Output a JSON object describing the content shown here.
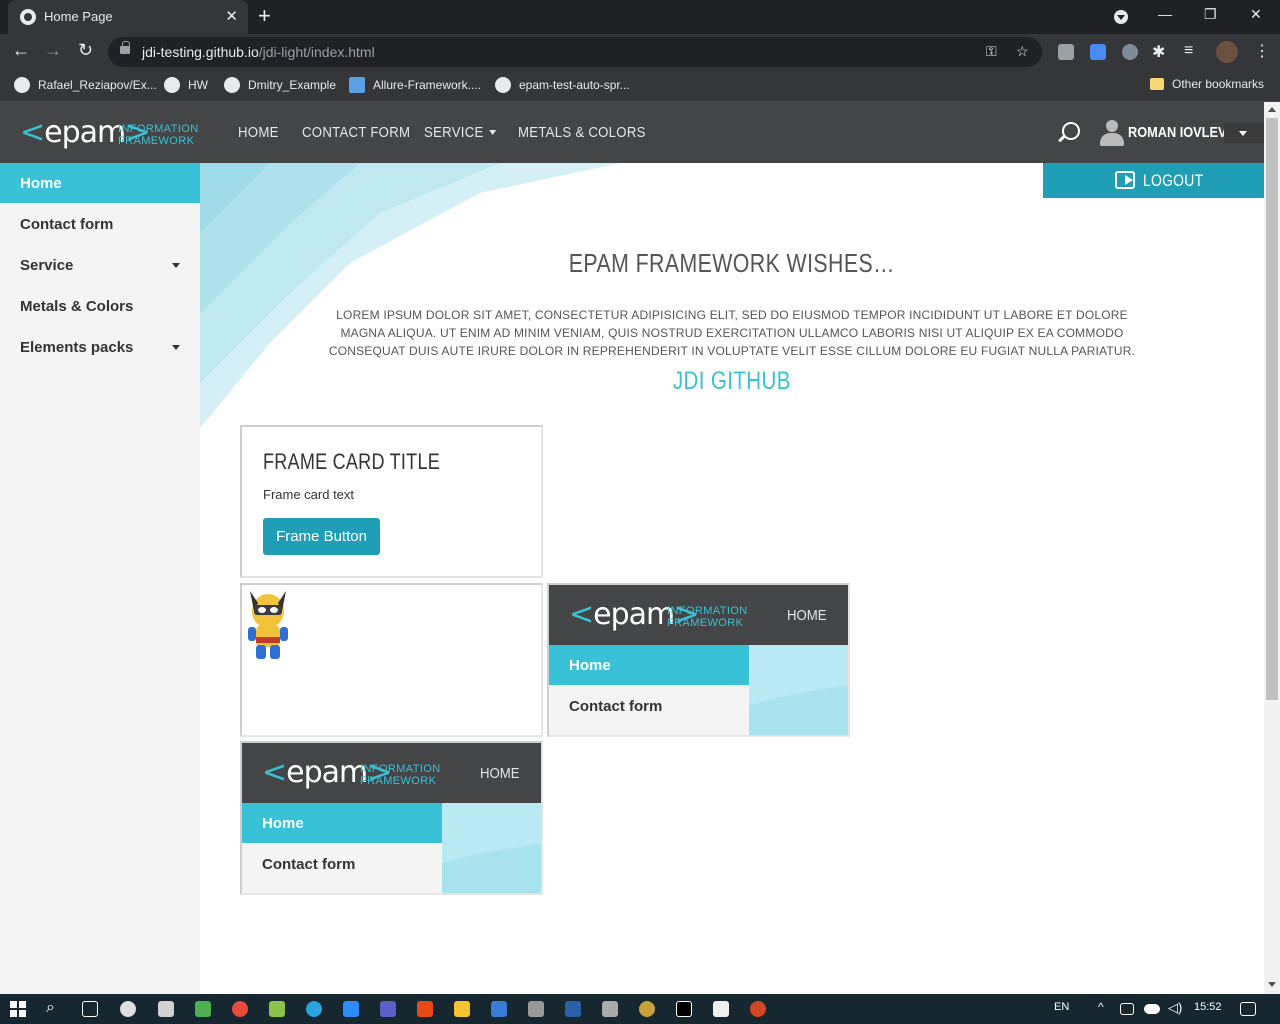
{
  "browser": {
    "tab_title": "Home Page",
    "tab_close": "✕",
    "new_tab": "+",
    "url_host": "jdi-testing.github.io",
    "url_path": "/jdi-light/index.html",
    "bookmarks": [
      {
        "label": "Rafael_Reziapov/Ex..."
      },
      {
        "label": "HW"
      },
      {
        "label": "Dmitry_Example"
      },
      {
        "label": "Allure-Framework...."
      },
      {
        "label": "epam-test-auto-spr..."
      }
    ],
    "other_bookmarks": "Other bookmarks",
    "win_min": "—",
    "win_restore": "❐",
    "win_close": "✕"
  },
  "site": {
    "logo_text_left": "<",
    "logo_text": "epam",
    "logo_text_right": ">",
    "logo_tag_line1": "INFORMATION",
    "logo_tag_line2": "FRAMEWORK",
    "nav": {
      "home": "HOME",
      "contact": "CONTACT FORM",
      "service": "SERVICE",
      "metals": "METALS & COLORS"
    },
    "user_name": "ROMAN IOVLEV",
    "logout": "LOGOUT",
    "sidebar": [
      {
        "label": "Home",
        "active": true
      },
      {
        "label": "Contact form"
      },
      {
        "label": "Service"
      },
      {
        "label": "Metals & Colors"
      },
      {
        "label": "Elements packs"
      }
    ],
    "main_title": "EPAM FRAMEWORK WISHES…",
    "main_text": "LOREM IPSUM DOLOR SIT AMET, CONSECTETUR ADIPISICING ELIT, SED DO EIUSMOD TEMPOR INCIDIDUNT UT LABORE ET DOLORE MAGNA ALIQUA. UT ENIM AD MINIM VENIAM, QUIS NOSTRUD EXERCITATION ULLAMCO LABORIS NISI UT ALIQUIP EX EA COMMODO CONSEQUAT DUIS AUTE IRURE DOLOR IN REPREHENDERIT IN VOLUPTATE VELIT ESSE CILLUM DOLORE EU FUGIAT NULLA PARIATUR.",
    "jdi_link": "JDI GITHUB",
    "frame_card": {
      "title": "FRAME CARD TITLE",
      "text": "Frame card text",
      "button": "Frame Button"
    },
    "mini_frame": {
      "home_nav": "HOME",
      "side_home": "Home",
      "side_contact": "Contact form"
    }
  },
  "taskbar": {
    "lang": "EN",
    "time": "15:52"
  },
  "colors": {
    "accent": "#39c2d7",
    "header_bg": "#444546",
    "logout_bg": "#1f9eb6",
    "green": "#9ac63f"
  }
}
